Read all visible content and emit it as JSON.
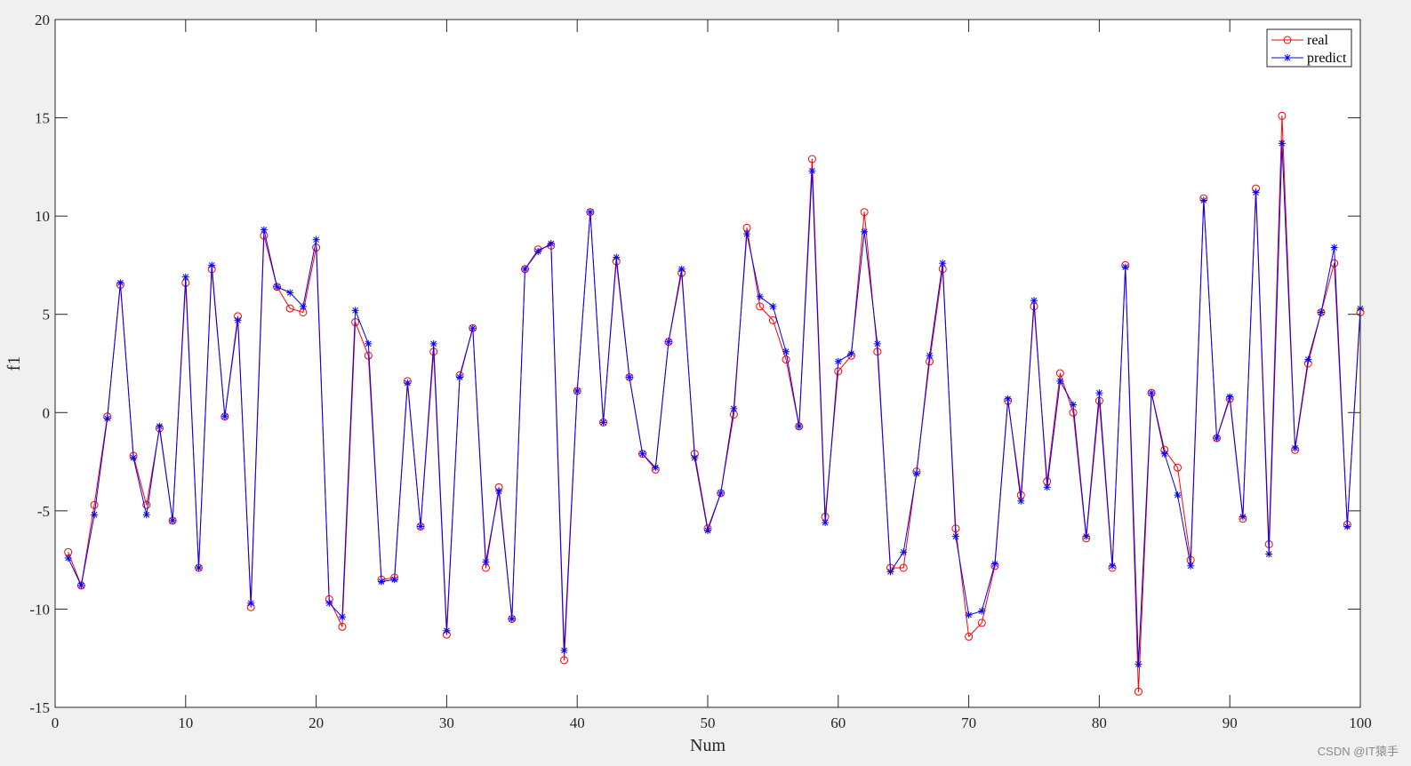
{
  "chart_data": {
    "type": "line",
    "xlabel": "Num",
    "ylabel": "f1",
    "xlim": [
      0,
      100
    ],
    "ylim": [
      -15,
      20
    ],
    "xticks": [
      0,
      10,
      20,
      30,
      40,
      50,
      60,
      70,
      80,
      90,
      100
    ],
    "yticks": [
      -15,
      -10,
      -5,
      0,
      5,
      10,
      15,
      20
    ],
    "grid": false,
    "legend_position": "top-right",
    "x": [
      1,
      2,
      3,
      4,
      5,
      6,
      7,
      8,
      9,
      10,
      11,
      12,
      13,
      14,
      15,
      16,
      17,
      18,
      19,
      20,
      21,
      22,
      23,
      24,
      25,
      26,
      27,
      28,
      29,
      30,
      31,
      32,
      33,
      34,
      35,
      36,
      37,
      38,
      39,
      40,
      41,
      42,
      43,
      44,
      45,
      46,
      47,
      48,
      49,
      50,
      51,
      52,
      53,
      54,
      55,
      56,
      57,
      58,
      59,
      60,
      61,
      62,
      63,
      64,
      65,
      66,
      67,
      68,
      69,
      70,
      71,
      72,
      73,
      74,
      75,
      76,
      77,
      78,
      79,
      80,
      81,
      82,
      83,
      84,
      85,
      86,
      87,
      88,
      89,
      90,
      91,
      92,
      93,
      94,
      95,
      96,
      97,
      98,
      99,
      100
    ],
    "series": [
      {
        "name": "real",
        "color": "#ff0000",
        "marker": "circle",
        "values": [
          -7.1,
          -8.8,
          -4.7,
          -0.2,
          6.5,
          -2.2,
          -4.7,
          -0.8,
          -5.5,
          6.6,
          -7.9,
          7.3,
          -0.2,
          4.9,
          -9.9,
          9.0,
          6.4,
          5.3,
          5.1,
          8.4,
          -9.5,
          -10.9,
          4.6,
          2.9,
          -8.5,
          -8.4,
          1.6,
          -5.8,
          3.1,
          -11.3,
          1.9,
          4.3,
          -7.9,
          -3.8,
          -10.5,
          7.3,
          8.3,
          8.5,
          -12.6,
          1.1,
          10.2,
          -0.5,
          7.7,
          1.8,
          -2.1,
          -2.9,
          3.6,
          7.1,
          -2.1,
          -5.9,
          -4.1,
          -0.1,
          9.4,
          5.4,
          4.7,
          2.7,
          -0.7,
          12.9,
          -5.3,
          2.1,
          2.9,
          10.2,
          3.1,
          -7.9,
          -7.9,
          -3.0,
          2.6,
          7.3,
          -5.9,
          -11.4,
          -10.7,
          -7.8,
          0.6,
          -4.2,
          5.4,
          -3.5,
          2.0,
          0.0,
          -6.4,
          0.6,
          -7.9,
          7.5,
          -14.2,
          1.0,
          -1.9,
          -2.8,
          -7.5,
          10.9,
          -1.3,
          0.7,
          -5.4,
          11.4,
          -6.7,
          15.1,
          -1.9,
          2.5,
          5.1,
          7.6,
          -5.7,
          5.1
        ]
      },
      {
        "name": "predict",
        "color": "#0000ff",
        "marker": "star",
        "values": [
          -7.4,
          -8.8,
          -5.2,
          -0.3,
          6.6,
          -2.3,
          -5.2,
          -0.7,
          -5.5,
          6.9,
          -7.9,
          7.5,
          -0.2,
          4.7,
          -9.7,
          9.3,
          6.4,
          6.1,
          5.4,
          8.8,
          -9.7,
          -10.4,
          5.2,
          3.5,
          -8.6,
          -8.5,
          1.5,
          -5.8,
          3.5,
          -11.1,
          1.8,
          4.3,
          -7.6,
          -4.0,
          -10.5,
          7.3,
          8.2,
          8.6,
          -12.1,
          1.1,
          10.2,
          -0.5,
          7.9,
          1.8,
          -2.1,
          -2.8,
          3.6,
          7.3,
          -2.3,
          -6.0,
          -4.1,
          0.2,
          9.1,
          5.9,
          5.4,
          3.1,
          -0.7,
          12.3,
          -5.6,
          2.6,
          3.0,
          9.2,
          3.5,
          -8.1,
          -7.1,
          -3.1,
          2.9,
          7.6,
          -6.3,
          -10.3,
          -10.1,
          -7.7,
          0.7,
          -4.5,
          5.7,
          -3.8,
          1.6,
          0.4,
          -6.3,
          1.0,
          -7.8,
          7.4,
          -12.8,
          1.0,
          -2.1,
          -4.2,
          -7.8,
          10.8,
          -1.3,
          0.8,
          -5.3,
          11.2,
          -7.2,
          13.7,
          -1.8,
          2.7,
          5.1,
          8.4,
          -5.8,
          5.3
        ]
      }
    ]
  },
  "watermark": "CSDN @IT猿手"
}
